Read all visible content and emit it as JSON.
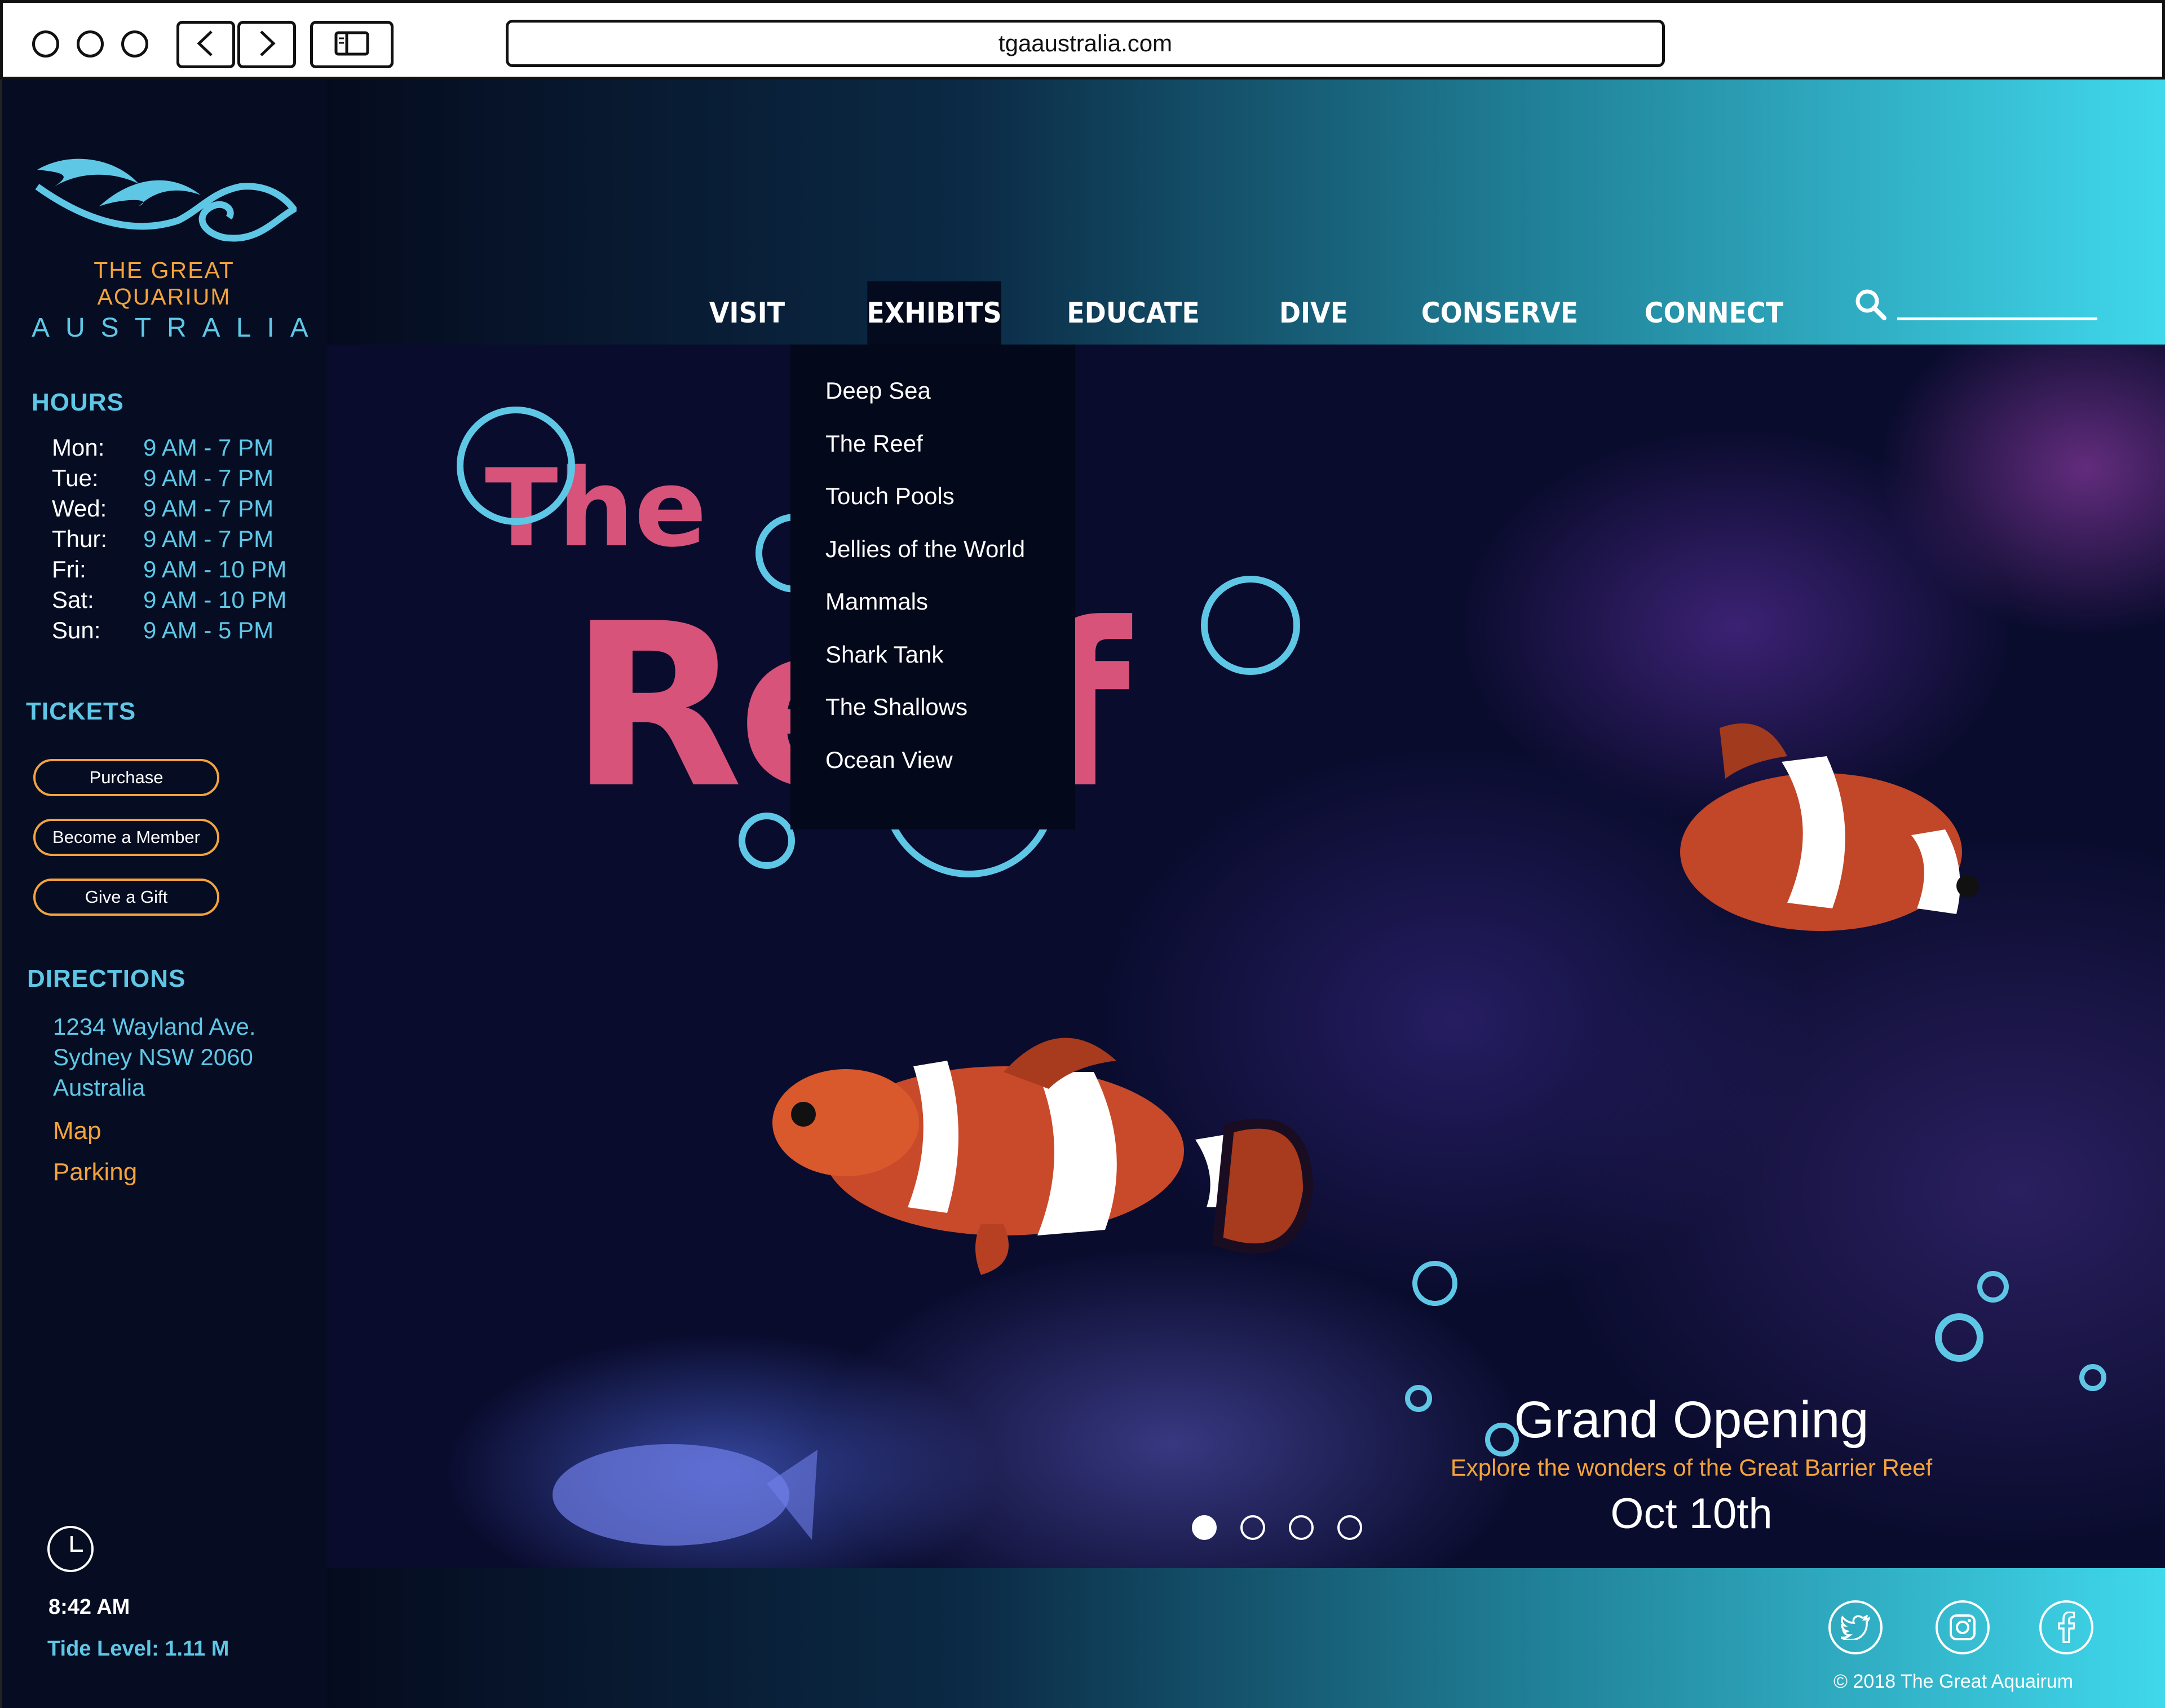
{
  "browser": {
    "url": "tgaaustralia.com"
  },
  "logo": {
    "line1": "THE GREAT AQUARIUM",
    "line2": "AUSTRALIA"
  },
  "hours": {
    "title": "HOURS",
    "rows": [
      {
        "day": "Mon:",
        "time": "9 AM - 7 PM"
      },
      {
        "day": "Tue:",
        "time": "9 AM - 7 PM"
      },
      {
        "day": "Wed:",
        "time": "9 AM - 7 PM"
      },
      {
        "day": "Thur:",
        "time": "9 AM - 7 PM"
      },
      {
        "day": "Fri:",
        "time": "9 AM - 10 PM"
      },
      {
        "day": "Sat:",
        "time": "9 AM - 10 PM"
      },
      {
        "day": "Sun:",
        "time": "9 AM - 5 PM"
      }
    ]
  },
  "tickets": {
    "title": "TICKETS",
    "purchase": "Purchase",
    "member": "Become a Member",
    "gift": "Give a Gift"
  },
  "directions": {
    "title": "DIRECTIONS",
    "line1": "1234 Wayland Ave.",
    "line2": "Sydney NSW 2060",
    "line3": "Australia",
    "map": "Map",
    "parking": "Parking"
  },
  "status": {
    "time": "8:42 AM",
    "tide": "Tide Level: 1.11 M"
  },
  "nav": {
    "visit": "VISIT",
    "exhibits": "EXHIBITS",
    "educate": "EDUCATE",
    "dive": "DIVE",
    "conserve": "CONSERVE",
    "connect": "CONNECT"
  },
  "dropdown": [
    "Deep Sea",
    "The Reef",
    "Touch Pools",
    "Jellies of the World",
    "Mammals",
    "Shark Tank",
    "The Shallows",
    "Ocean View"
  ],
  "hero": {
    "title_word1": "The",
    "title_word2": "Reef",
    "event_title": "Grand Opening",
    "event_sub": "Explore the wonders of the Great Barrier Reef",
    "event_date": "Oct 10th",
    "slide_count": 4,
    "active_slide": 1
  },
  "footer": {
    "copyright": "© 2018 The Great Aquairum",
    "social": [
      "twitter-icon",
      "instagram-icon",
      "facebook-icon"
    ]
  },
  "colors": {
    "accent_cyan": "#5fc7e6",
    "accent_orange": "#f4a33a",
    "accent_pink": "#d7537a",
    "background": "#050b1e"
  }
}
